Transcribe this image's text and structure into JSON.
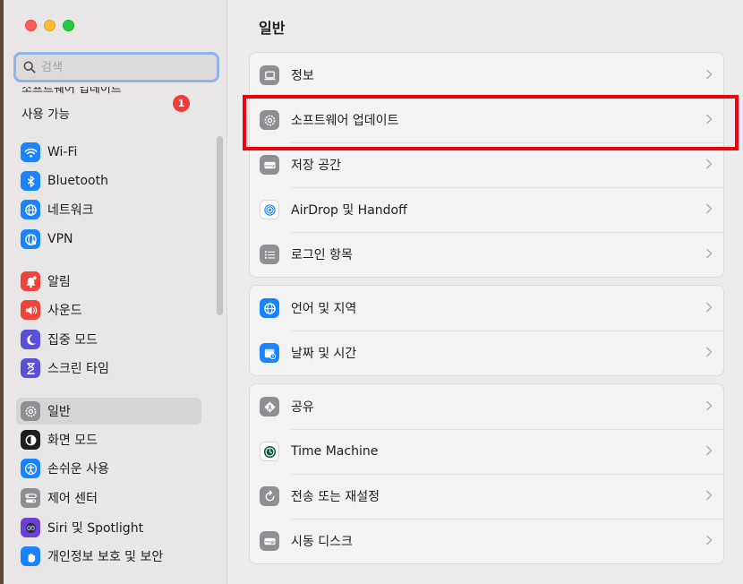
{
  "sidebar": {
    "search_placeholder": "검색",
    "update_notice": {
      "line1": "소프트웨어 업데이트",
      "line2": "사용 가능",
      "badge": "1"
    },
    "items": [
      {
        "label": "Wi-Fi",
        "icon": "wifi-icon",
        "color": "#1a84ff"
      },
      {
        "label": "Bluetooth",
        "icon": "bluetooth-icon",
        "color": "#1a84ff"
      },
      {
        "label": "네트워크",
        "icon": "network-globe-icon",
        "color": "#1a84ff"
      },
      {
        "label": "VPN",
        "icon": "vpn-globe-icon",
        "color": "#1a84ff"
      },
      {
        "label": "알림",
        "icon": "notifications-bell-icon",
        "color": "#f0433a"
      },
      {
        "label": "사운드",
        "icon": "sound-speaker-icon",
        "color": "#f0433a"
      },
      {
        "label": "집중 모드",
        "icon": "focus-moon-icon",
        "color": "#5a50d8"
      },
      {
        "label": "스크린 타임",
        "icon": "screen-time-hourglass-icon",
        "color": "#5a50d8"
      },
      {
        "label": "일반",
        "icon": "general-gear-icon",
        "color": "#8e8e93",
        "selected": true
      },
      {
        "label": "화면 모드",
        "icon": "appearance-icon",
        "color": "#1d1d1f"
      },
      {
        "label": "손쉬운 사용",
        "icon": "accessibility-icon",
        "color": "#1a84ff"
      },
      {
        "label": "제어 센터",
        "icon": "control-center-icon",
        "color": "#8e8e93"
      },
      {
        "label": "Siri 및 Spotlight",
        "icon": "siri-icon",
        "color": "#6a3fd8"
      },
      {
        "label": "개인정보 보호 및 보안",
        "icon": "privacy-hand-icon",
        "color": "#1a84ff"
      }
    ]
  },
  "main": {
    "title": "일반",
    "groups": [
      [
        {
          "label": "정보",
          "icon": "about-laptop-icon",
          "color": "#8e8e93"
        },
        {
          "label": "소프트웨어 업데이트",
          "icon": "software-update-gear-icon",
          "color": "#8e8e93"
        },
        {
          "label": "저장 공간",
          "icon": "storage-drive-icon",
          "color": "#8e8e93"
        },
        {
          "label": "AirDrop 및 Handoff",
          "icon": "airdrop-icon",
          "color": "#ffffff"
        },
        {
          "label": "로그인 항목",
          "icon": "login-items-list-icon",
          "color": "#8e8e93"
        }
      ],
      [
        {
          "label": "언어 및 지역",
          "icon": "language-globe-icon",
          "color": "#1a84ff"
        },
        {
          "label": "날짜 및 시간",
          "icon": "date-time-calendar-icon",
          "color": "#1a84ff"
        }
      ],
      [
        {
          "label": "공유",
          "icon": "sharing-icon",
          "color": "#8e8e93"
        },
        {
          "label": "Time Machine",
          "icon": "time-machine-icon",
          "color": "#ffffff"
        },
        {
          "label": "전송 또는 재설정",
          "icon": "transfer-reset-icon",
          "color": "#8e8e93"
        },
        {
          "label": "시동 디스크",
          "icon": "startup-disk-icon",
          "color": "#8e8e93"
        }
      ]
    ]
  },
  "highlight_color": "#f20010"
}
